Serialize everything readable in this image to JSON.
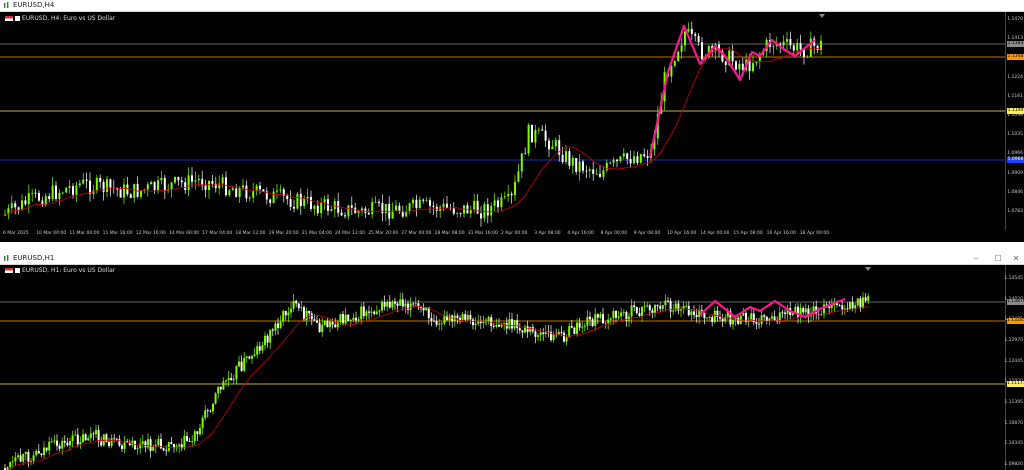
{
  "windows": [
    {
      "id": "h4",
      "title": "EURUSD,H4",
      "symbol_label": "EURUSD, H4: Euro vs US Dollar",
      "controls": [
        "–",
        "☐",
        "✕"
      ],
      "price_labels": [
        "1.1470",
        "1.1413",
        "1.1327",
        "1.1224",
        "1.1161",
        "1.1098",
        "1.1035",
        "1.0966",
        "1.0909",
        "1.0846",
        "1.0783"
      ],
      "tags": [
        {
          "text": "1.1383",
          "color": "#8a8a8a"
        },
        {
          "text": "1.1348",
          "color": "#ff9800"
        },
        {
          "text": "1.1149",
          "color": "#ffee58"
        },
        {
          "text": "1.0966",
          "color": "#1e40ff"
        }
      ],
      "time_labels": [
        "6 Mar 2025",
        "10 Mar 00:00",
        "11 Mar 00:00",
        "11 Mar 16:00",
        "12 Mar 16:00",
        "14 Mar 00:00",
        "17 Mar 04:00",
        "18 Mar 12:00",
        "19 Mar 20:00",
        "21 Mar 04:00",
        "24 Mar 12:00",
        "25 Mar 20:00",
        "27 Mar 00:00",
        "28 Mar 08:00",
        "31 Mar 16:00",
        "2 Apr 00:00",
        "3 Apr 08:00",
        "4 Apr 16:00",
        "8 Apr 00:00",
        "9 Apr 08:00",
        "10 Apr 16:00",
        "14 Apr 00:00",
        "15 Apr 08:00",
        "16 Apr 16:00",
        "18 Apr 00:00"
      ],
      "first_time_label": "Mar 2025"
    },
    {
      "id": "h1",
      "title": "EURUSD,H1",
      "symbol_label": "EURUSD, H1: Euro vs US Dollar",
      "controls": [
        "–",
        "☐",
        "✕"
      ],
      "price_labels": [
        "1.14545",
        "1.14020",
        "1.13495",
        "1.12970",
        "1.12445",
        "1.11920",
        "1.11395",
        "1.10870",
        "1.10345",
        "1.09820"
      ],
      "tags": [
        {
          "text": "1.13870",
          "color": "#8a8a8a"
        },
        {
          "text": "1.13285",
          "color": "#ff9800"
        },
        {
          "text": "1.11177",
          "color": "#ffee58"
        }
      ]
    }
  ],
  "colors": {
    "bull": "#7cfc00",
    "bear": "#ffffff",
    "ma": "#cc0000",
    "zigzag": "#ff1493",
    "line_orange": "#ff9800",
    "line_yellow": "#ffee58",
    "line_blue": "#1e40ff",
    "line_grey": "#8a8a8a"
  }
}
